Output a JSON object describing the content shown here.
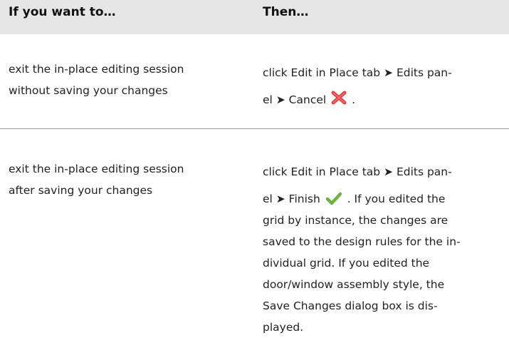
{
  "header": {
    "col1": "If you want to…",
    "col2": "Then…"
  },
  "rows": [
    {
      "action": [
        "exit the in-place editing session",
        "without saving your changes"
      ],
      "then": {
        "line1": "click Edit in Place tab ➤ Edits pan-",
        "line2_before_icon": "el ➤ Cancel",
        "line2_after_icon": ".",
        "icon": "cancel-x-icon"
      }
    },
    {
      "action": [
        "exit the in-place editing session",
        "after saving your changes"
      ],
      "then": {
        "line1": "click Edit in Place tab ➤ Edits pan-",
        "line2_before_icon": "el ➤ Finish",
        "line2_after_icon": ". If you edited the",
        "icon": "finish-check-icon",
        "rest": [
          "grid by instance, the changes are",
          "saved to the design rules for the in-",
          "dividual grid. If you edited the",
          "door/window assembly style, the",
          "Save Changes dialog box is dis-",
          "played."
        ]
      }
    }
  ],
  "colors": {
    "header_bg": "#e6e6e6",
    "rule": "#9a9a9a",
    "cancel_red": "#e03c3c",
    "finish_green": "#6db33f"
  }
}
